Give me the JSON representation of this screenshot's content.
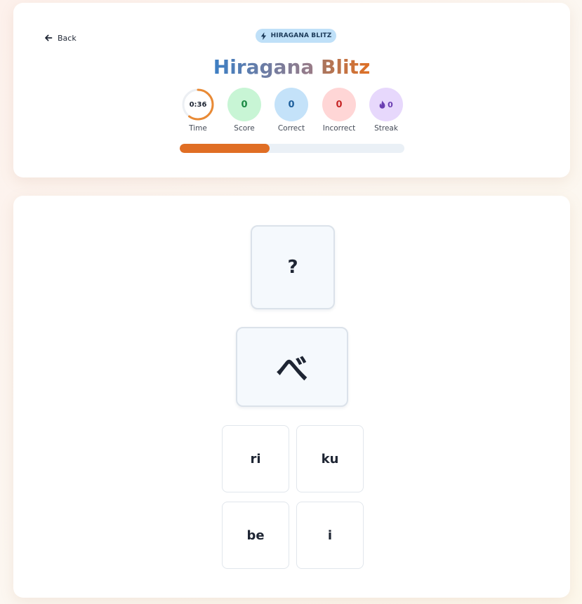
{
  "header": {
    "back_label": "Back",
    "badge_label": "HIRAGANA BLITZ",
    "title_word1": "Hiragana",
    "title_word2": "Blitz"
  },
  "stats": {
    "time": {
      "value": "0:36",
      "label": "Time",
      "remaining_fraction": 0.6
    },
    "score": {
      "value": "0",
      "label": "Score"
    },
    "correct": {
      "value": "0",
      "label": "Correct"
    },
    "incorrect": {
      "value": "0",
      "label": "Incorrect"
    },
    "streak": {
      "value": "0",
      "label": "Streak"
    }
  },
  "progress": {
    "fraction": 0.4
  },
  "game": {
    "prompt": "?",
    "kana": "べ",
    "answers": [
      "ri",
      "ku",
      "be",
      "i"
    ]
  },
  "icons": {
    "back": "arrow-left-icon",
    "badge": "lightning-icon",
    "streak": "flame-icon"
  },
  "colors": {
    "accent_orange": "#e06e24",
    "accent_blue": "#3c7ec4",
    "score_green": "#1c8a44",
    "correct_blue": "#1e5f9c",
    "incorrect_red": "#c72828",
    "streak_purple": "#6b3fb2"
  }
}
